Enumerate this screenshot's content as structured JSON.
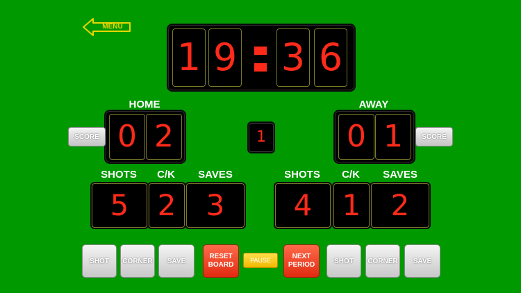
{
  "menu": {
    "label": "MENU"
  },
  "clock": {
    "minutes_tens": "1",
    "minutes_ones": "9",
    "seconds_tens": "3",
    "seconds_ones": "6"
  },
  "period": "1",
  "home": {
    "label": "HOME",
    "score_tens": "0",
    "score_ones": "2",
    "shots": "5",
    "ck": "2",
    "saves": "3",
    "score_button": "SCORE"
  },
  "away": {
    "label": "AWAY",
    "score_tens": "0",
    "score_ones": "1",
    "shots": "4",
    "ck": "1",
    "saves": "2",
    "score_button": "SCORE"
  },
  "stat_labels": {
    "shots": "SHOTS",
    "ck": "C/K",
    "saves": "SAVES"
  },
  "buttons": {
    "home_shot": "SHOT",
    "home_corner": "CORNER",
    "home_save": "SAVE",
    "reset_line1": "RESET",
    "reset_line2": "BOARD",
    "pause": "PAUSE",
    "next_line1": "NEXT",
    "next_line2": "PERIOD",
    "away_shot": "SHOT",
    "away_corner": "CORNER",
    "away_save": "SAVE"
  },
  "colors": {
    "background": "#009900",
    "digit": "#ff2a1a",
    "accent": "#e8d600"
  }
}
